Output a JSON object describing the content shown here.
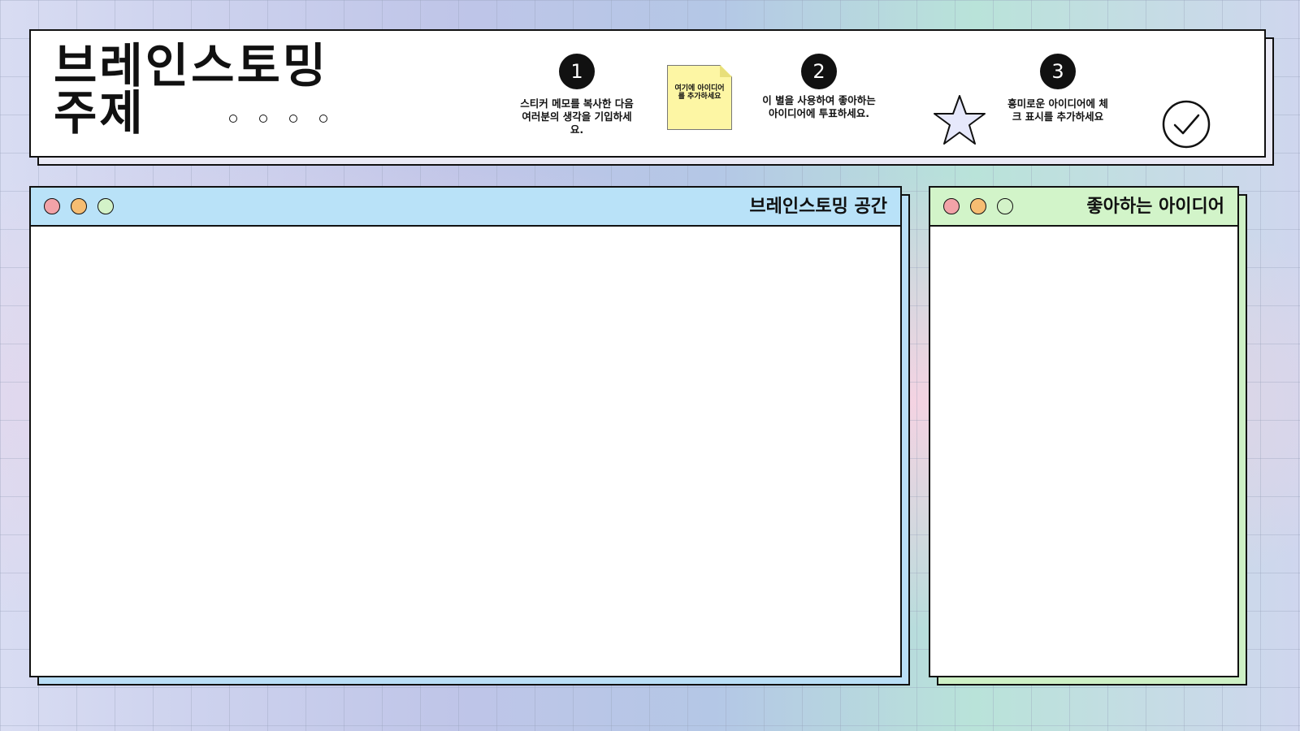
{
  "header": {
    "title_line1": "브레인스토밍",
    "title_line2": "주제",
    "steps": [
      {
        "number": "1",
        "text": "스티커 메모를 복사한 다음 여러분의 생각을 기입하세요."
      },
      {
        "number": "2",
        "text": "이 별을 사용하여 좋아하는 아이디어에 투표하세요."
      },
      {
        "number": "3",
        "text": "흥미로운 아이디어에 체크 표시를 추가하세요"
      }
    ],
    "sticky_note": "여기에 아이디어를 추가하세요"
  },
  "brainstorm_window": {
    "title": "브레인스토밍 공간"
  },
  "favorites_window": {
    "title": "좋아하는 아이디어"
  },
  "icons": {
    "step_marker": "numbered-circle",
    "vote": "star-icon",
    "mark": "checkmark-circle-icon",
    "window_controls": [
      "red-dot",
      "orange-dot",
      "green-dot"
    ]
  },
  "colors": {
    "window_dot_red": "#f2a3a8",
    "window_dot_orange": "#f6bd72",
    "window_dot_green": "#d3f2c8",
    "star_fill": "#e6e8fb",
    "sticky_fill": "#fdf6a4",
    "brainstorm_bar": "#b9e2f8",
    "favorites_bar": "#d2f4c9"
  }
}
